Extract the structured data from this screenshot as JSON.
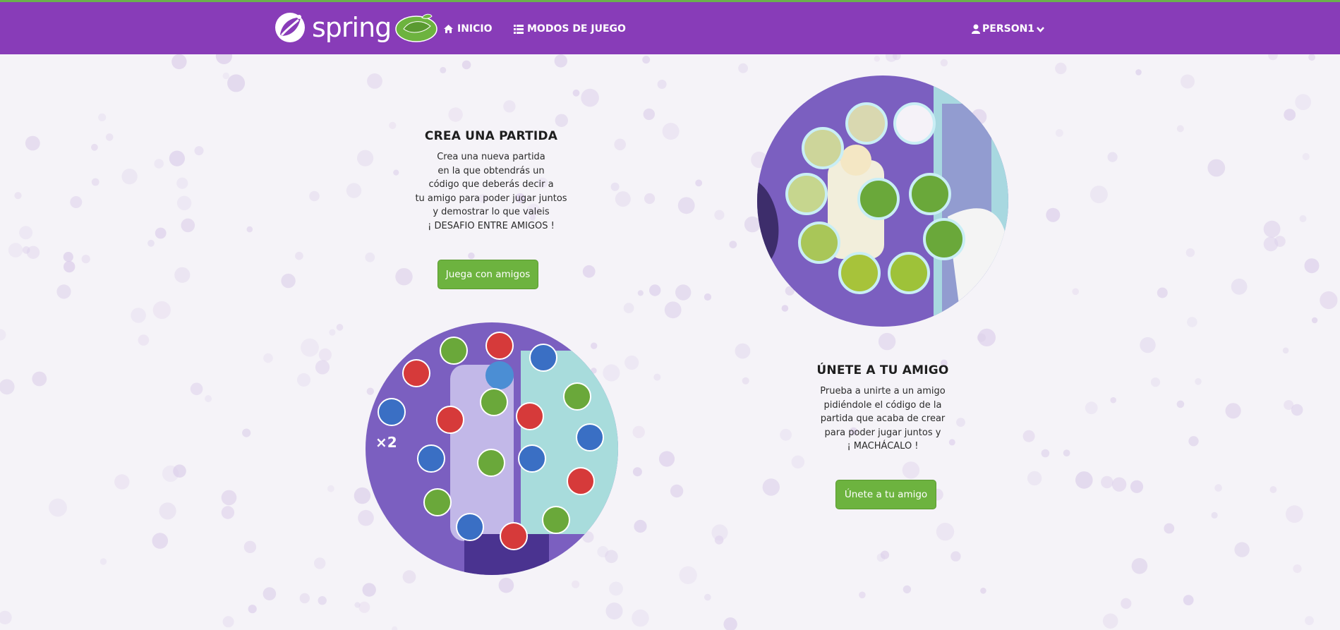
{
  "navbar": {
    "brand_text": "spring",
    "links": [
      {
        "label": "INICIO",
        "icon": "home-icon"
      },
      {
        "label": "MODOS DE JUEGO",
        "icon": "list-icon"
      }
    ],
    "user": {
      "label": "PERSON1",
      "icon": "user-icon",
      "caret": "chevron-down-icon"
    }
  },
  "create_card": {
    "title": "CREA UNA PARTIDA",
    "lines": [
      "Crea una nueva partida",
      "en la que obtendrás un",
      "código que deberás decir a",
      "tu amigo para poder jugar juntos",
      "y demostrar lo que valeis",
      "¡ DESAFIO ENTRE AMIGOS !"
    ],
    "button": "Juega con amigos"
  },
  "join_card": {
    "title": "ÚNETE A TU AMIGO",
    "lines": [
      "Prueba a unirte a un amigo",
      "pidiéndole el código de la",
      "partida que acaba de crear",
      "para poder jugar juntos y",
      "¡ MACHÁCALO !"
    ],
    "button": "Únete a tu amigo"
  },
  "illustration_bottom": {
    "multiplier": "×2"
  },
  "colors": {
    "navbar": "#883cb8",
    "accent_green": "#6db33f",
    "navbar_top_border": "#6ab04c"
  }
}
